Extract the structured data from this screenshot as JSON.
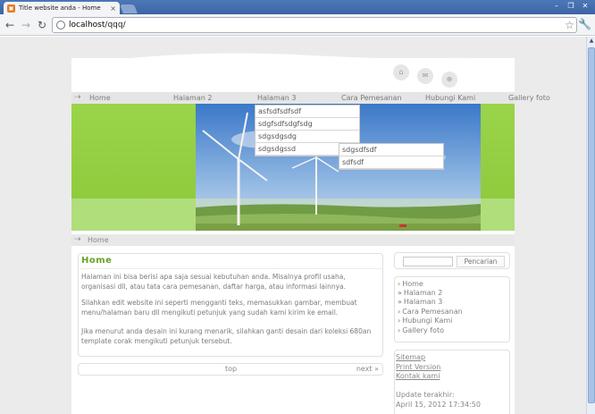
{
  "browser": {
    "tab_title": "Title website anda - Home",
    "url_host": "localhost",
    "url_path": "/qqq/"
  },
  "nav": {
    "items": [
      "Home",
      "Halaman 2",
      "Halaman 3",
      "Cara Pemesanan",
      "Hubungi Kami",
      "Gallery foto"
    ]
  },
  "dropdown_1": {
    "items": [
      "asfsdfsdfsdf",
      "sdgfsdfsdgfsdg",
      "sdgsdgsdg",
      "sdgsdgssd"
    ]
  },
  "dropdown_2": {
    "items": [
      "sdgsdfsdf",
      "sdfsdf"
    ]
  },
  "breadcrumb": {
    "text": "Home"
  },
  "main": {
    "title": "Home",
    "paragraphs": [
      "Halaman ini bisa berisi apa saja sesuai kebutuhan anda. Misalnya profil usaha, organisasi dll, atau tata cara pemesanan, daftar harga, atau informasi lainnya.",
      "Silahkan edit website ini seperti mengganti teks, memasukkan gambar, membuat menu/halaman baru dll mengikuti petunjuk yang sudah kami kirim ke email.",
      "Jika menurut anda desain ini kurang menarik, silahkan ganti desain dari koleksi 680an template corak mengikuti petunjuk tersebut."
    ]
  },
  "pager": {
    "top": "top",
    "next": "next »"
  },
  "sidebar": {
    "search_button": "Pencarian",
    "menu": [
      {
        "marker": "›",
        "label": "Home"
      },
      {
        "marker": "»",
        "label": "Halaman 2"
      },
      {
        "marker": "»",
        "label": "Halaman 3"
      },
      {
        "marker": "›",
        "label": "Cara Pemesanan"
      },
      {
        "marker": "›",
        "label": "Hubungi Kami"
      },
      {
        "marker": "›",
        "label": "Gallery foto"
      }
    ],
    "links": [
      "Sitemap",
      "Print Version",
      "Kontak kami"
    ],
    "update_label": "Update terakhir:",
    "update_value": "April 15, 2012 17:34:50"
  },
  "colors": {
    "accent_green": "#6aa324",
    "banner_green": "#9ad44a"
  }
}
